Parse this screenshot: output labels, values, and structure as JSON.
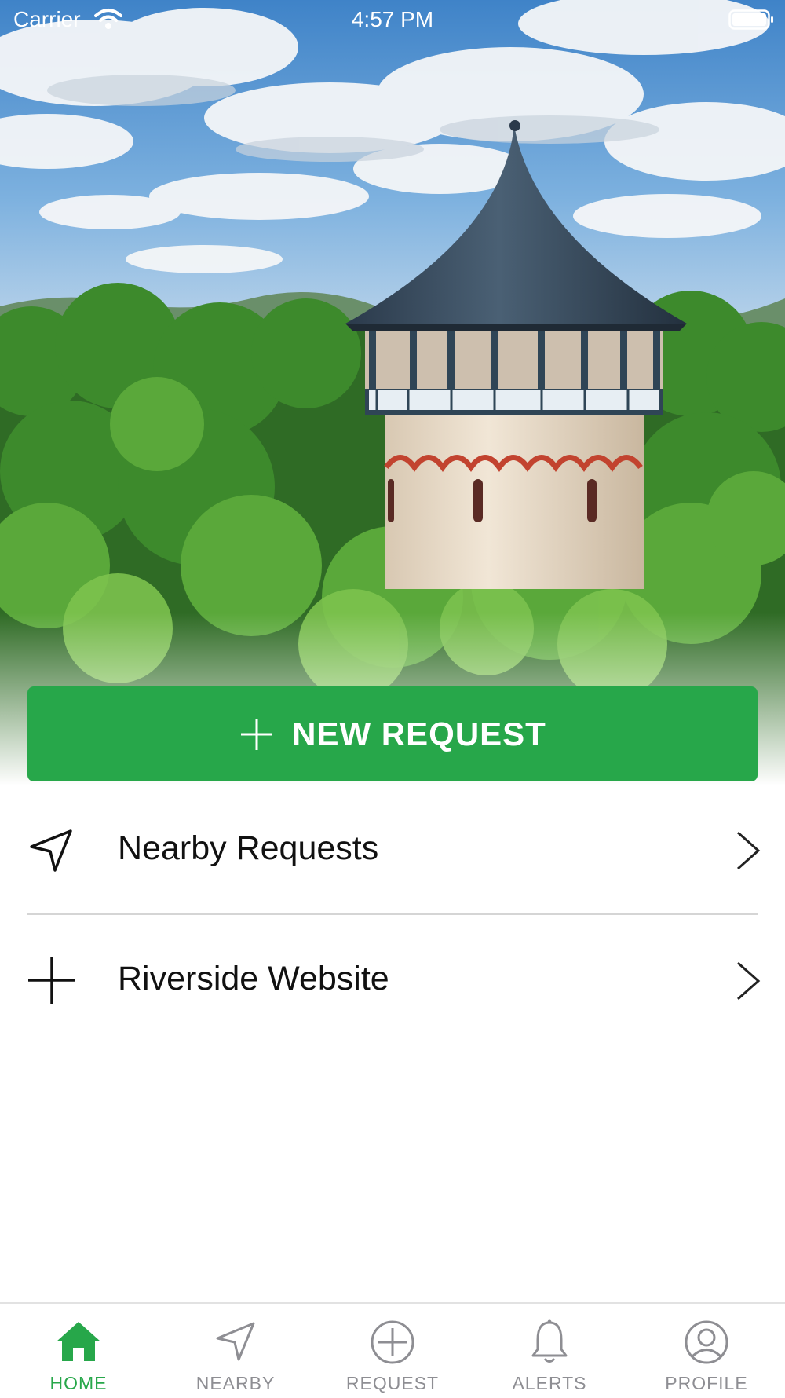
{
  "status_bar": {
    "carrier": "Carrier",
    "time": "4:57 PM",
    "wifi_icon": "wifi-icon",
    "battery_icon": "battery-icon"
  },
  "hero": {
    "image": "water-tower-over-trees-photo"
  },
  "new_request_button": {
    "icon": "plus-icon",
    "label": "NEW REQUEST"
  },
  "menu": {
    "items": [
      {
        "icon": "location-arrow-icon",
        "label": "Nearby Requests"
      },
      {
        "icon": "plus-icon",
        "label": "Riverside Website"
      }
    ]
  },
  "tab_bar": {
    "tabs": [
      {
        "icon": "home-icon",
        "label": "HOME",
        "active": true
      },
      {
        "icon": "location-arrow-icon",
        "label": "NEARBY",
        "active": false
      },
      {
        "icon": "plus-circle-icon",
        "label": "REQUEST",
        "active": false
      },
      {
        "icon": "bell-icon",
        "label": "ALERTS",
        "active": false
      },
      {
        "icon": "user-circle-icon",
        "label": "PROFILE",
        "active": false
      }
    ]
  },
  "colors": {
    "accent": "#27a74a",
    "tab_inactive": "#8e8e93",
    "text": "#111111"
  }
}
